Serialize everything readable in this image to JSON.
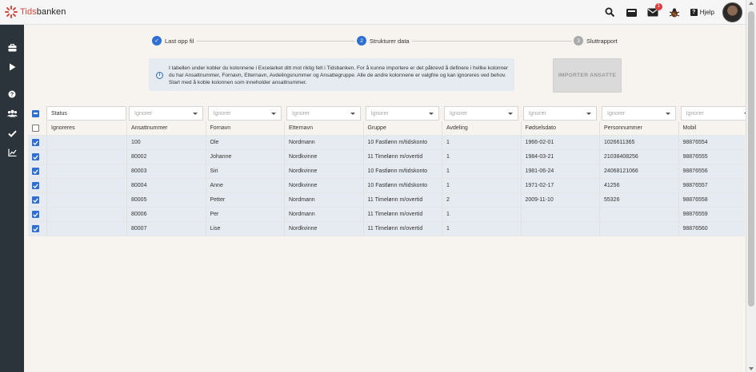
{
  "header": {
    "logo_prefix": "Tids",
    "logo_rest": "banken",
    "mail_badge": "1",
    "help_label": "Hjelp"
  },
  "stepper": {
    "steps": [
      {
        "label": "Last opp fil",
        "state": "done",
        "marker": "✓"
      },
      {
        "label": "Strukturer data",
        "state": "active",
        "marker": "2"
      },
      {
        "label": "Sluttrapport",
        "state": "pending",
        "marker": "3"
      }
    ]
  },
  "info": {
    "icon": "i",
    "text": "I tabellen under kobler du kolonnene i Excelarket ditt mot riktig felt i Tidsbanken. For å kunne importere er det påkrevd å definere i hvilke kolonner du har Ansattnummer, Fornavn, Etternavn, Avdelingsnummer og Ansattegruppe. Alle de andre kolonnene er valgfrie og kan ignoreres ved behov. Start med å koble kolonnen som inneholder ansattnummer."
  },
  "import_button": "IMPORTER ANSATTE",
  "table": {
    "status_label": "Status",
    "select_placeholder": "Ignorer",
    "ignore_label": "Ignoreres",
    "columns": [
      "Ansattnummer",
      "Fornavn",
      "Etternavn",
      "Gruppe",
      "Avdeling",
      "Fødselsdato",
      "Personnummer",
      "Mobil"
    ],
    "rows": [
      [
        "100",
        "Ole",
        "Nordmann",
        "10 Fastlønn m/tidskonto",
        "1",
        "1966-02-01",
        "1026611365",
        "98876554"
      ],
      [
        "80002",
        "Johanne",
        "Nordkvinne",
        "11 Timelønn m/overtid",
        "1",
        "1984-03-21",
        "21038408256",
        "98876555"
      ],
      [
        "80003",
        "Siri",
        "Nordkvinne",
        "10 Fastlønn m/tidskonto",
        "1",
        "1981-06-24",
        "24068121066",
        "98876556"
      ],
      [
        "80004",
        "Anne",
        "Nordkvinne",
        "10 Fastlønn m/tidskonto",
        "1",
        "1971-02-17",
        "41256",
        "98876557"
      ],
      [
        "80005",
        "Petter",
        "Nordmann",
        "11 Timelønn m/overtid",
        "2",
        "2009-11-10",
        "55326",
        "98876558"
      ],
      [
        "80006",
        "Per",
        "Nordmann",
        "11 Timelønn m/overtid",
        "1",
        "",
        "",
        "98876559"
      ],
      [
        "80007",
        "Lise",
        "Nordkvinne",
        "11 Timelønn m/overtid",
        "1",
        "",
        "",
        "98876560"
      ]
    ]
  },
  "colors": {
    "brand_red": "#d6453a",
    "sidebar": "#2b333b",
    "accent_blue": "#2f6fd1",
    "row_bg": "#e6ebf1",
    "page_bg": "#f7f4ef"
  }
}
